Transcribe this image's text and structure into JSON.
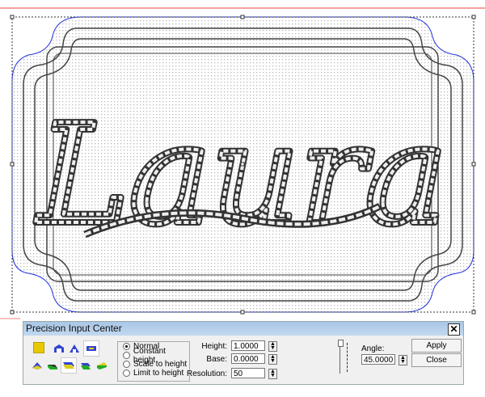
{
  "dialog": {
    "title": "Precision Input Center",
    "close_icon": "close-icon",
    "modes": [
      {
        "label": "Normal",
        "checked": true
      },
      {
        "label": "Constant height",
        "checked": false
      },
      {
        "label": "Scale to height",
        "checked": false
      },
      {
        "label": "Limit to height",
        "checked": false
      }
    ],
    "height_label": "Height:",
    "height_value": "1.0000",
    "base_label": "Base:",
    "base_value": "0.0000",
    "resolution_label": "Resolution:",
    "resolution_value": "50",
    "angle_label": "Angle:",
    "angle_value": "45.0000",
    "apply_label": "Apply",
    "close_label": "Close"
  },
  "canvas": {
    "text": "Laura",
    "colors": {
      "outline": "#2233dd",
      "guide": "#e03030",
      "swatch": "#e8c800"
    }
  }
}
